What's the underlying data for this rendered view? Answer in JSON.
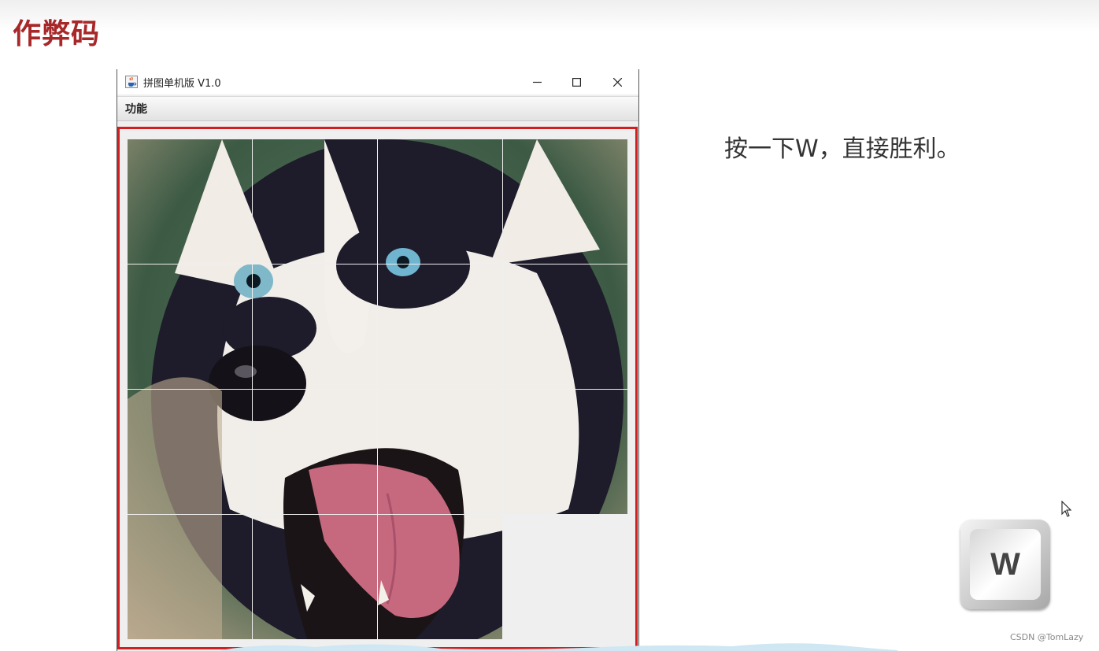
{
  "slide": {
    "title": "作弊码"
  },
  "window": {
    "title": "拼图单机版 V1.0",
    "icons": {
      "app": "java-cup-icon",
      "minimize": "minimize-icon",
      "maximize": "maximize-icon",
      "close": "close-icon"
    }
  },
  "menu": {
    "items": [
      "功能"
    ]
  },
  "puzzle": {
    "rows": 4,
    "cols": 4,
    "empty_slot": {
      "row": 4,
      "col": 4
    },
    "image": "husky-dog-photo",
    "colors": {
      "grid_line": "#ffffff",
      "empty": "#efefef",
      "frame": "#d21e1e"
    }
  },
  "instruction": {
    "text": "按一下W，直接胜利。"
  },
  "key": {
    "label": "W"
  },
  "watermark": {
    "text": "CSDN @TomLazy"
  },
  "colors": {
    "title": "#a8282a",
    "accent": "#d21e1e"
  }
}
